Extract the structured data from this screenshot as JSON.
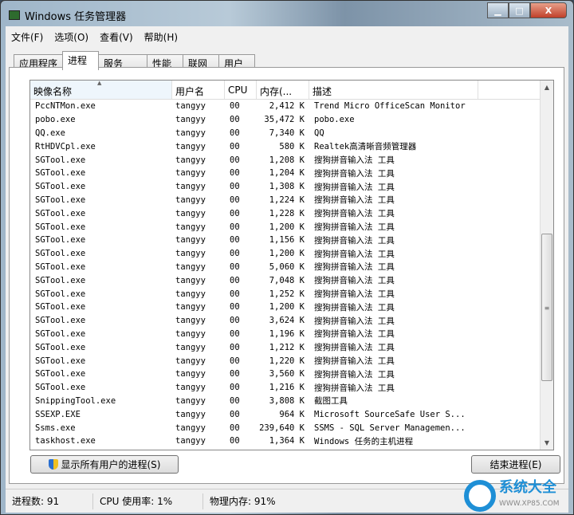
{
  "window": {
    "title": "Windows 任务管理器",
    "close": "X"
  },
  "menu": [
    "文件(F)",
    "选项(O)",
    "查看(V)",
    "帮助(H)"
  ],
  "tabs": [
    "应用程序",
    "进程",
    "服务",
    "性能",
    "联网",
    "用户"
  ],
  "active_tab": 1,
  "columns": [
    "映像名称",
    "用户名",
    "CPU",
    "内存(...",
    "描述"
  ],
  "rows": [
    [
      "PccNTMon.exe",
      "tangyy",
      "00",
      "2,412 K",
      "Trend Micro OfficeScan Monitor"
    ],
    [
      "pobo.exe",
      "tangyy",
      "00",
      "35,472 K",
      "pobo.exe"
    ],
    [
      "QQ.exe",
      "tangyy",
      "00",
      "7,340 K",
      "QQ"
    ],
    [
      "RtHDVCpl.exe",
      "tangyy",
      "00",
      "580 K",
      "Realtek高清晰音频管理器"
    ],
    [
      "SGTool.exe",
      "tangyy",
      "00",
      "1,208 K",
      "搜狗拼音输入法 工具"
    ],
    [
      "SGTool.exe",
      "tangyy",
      "00",
      "1,204 K",
      "搜狗拼音输入法 工具"
    ],
    [
      "SGTool.exe",
      "tangyy",
      "00",
      "1,308 K",
      "搜狗拼音输入法 工具"
    ],
    [
      "SGTool.exe",
      "tangyy",
      "00",
      "1,224 K",
      "搜狗拼音输入法 工具"
    ],
    [
      "SGTool.exe",
      "tangyy",
      "00",
      "1,228 K",
      "搜狗拼音输入法 工具"
    ],
    [
      "SGTool.exe",
      "tangyy",
      "00",
      "1,200 K",
      "搜狗拼音输入法 工具"
    ],
    [
      "SGTool.exe",
      "tangyy",
      "00",
      "1,156 K",
      "搜狗拼音输入法 工具"
    ],
    [
      "SGTool.exe",
      "tangyy",
      "00",
      "1,200 K",
      "搜狗拼音输入法 工具"
    ],
    [
      "SGTool.exe",
      "tangyy",
      "00",
      "5,060 K",
      "搜狗拼音输入法 工具"
    ],
    [
      "SGTool.exe",
      "tangyy",
      "00",
      "7,048 K",
      "搜狗拼音输入法 工具"
    ],
    [
      "SGTool.exe",
      "tangyy",
      "00",
      "1,252 K",
      "搜狗拼音输入法 工具"
    ],
    [
      "SGTool.exe",
      "tangyy",
      "00",
      "1,200 K",
      "搜狗拼音输入法 工具"
    ],
    [
      "SGTool.exe",
      "tangyy",
      "00",
      "3,624 K",
      "搜狗拼音输入法 工具"
    ],
    [
      "SGTool.exe",
      "tangyy",
      "00",
      "1,196 K",
      "搜狗拼音输入法 工具"
    ],
    [
      "SGTool.exe",
      "tangyy",
      "00",
      "1,212 K",
      "搜狗拼音输入法 工具"
    ],
    [
      "SGTool.exe",
      "tangyy",
      "00",
      "1,220 K",
      "搜狗拼音输入法 工具"
    ],
    [
      "SGTool.exe",
      "tangyy",
      "00",
      "3,560 K",
      "搜狗拼音输入法 工具"
    ],
    [
      "SGTool.exe",
      "tangyy",
      "00",
      "1,216 K",
      "搜狗拼音输入法 工具"
    ],
    [
      "SnippingTool.exe",
      "tangyy",
      "00",
      "3,808 K",
      "截图工具"
    ],
    [
      "SSEXP.EXE",
      "tangyy",
      "00",
      "964 K",
      "Microsoft SourceSafe User S..."
    ],
    [
      "Ssms.exe",
      "tangyy",
      "00",
      "239,640 K",
      "SSMS - SQL Server Managemen..."
    ],
    [
      "taskhost.exe",
      "tangyy",
      "00",
      "1,364 K",
      "Windows 任务的主机进程"
    ]
  ],
  "buttons": {
    "show_all": "显示所有用户的进程(S)",
    "end_process": "结束进程(E)"
  },
  "status": {
    "processes": "进程数: 91",
    "cpu": "CPU 使用率: 1%",
    "memory": "物理内存: 91%"
  },
  "watermark": {
    "name": "系统大全",
    "url": "WWW.XP85.COM"
  }
}
